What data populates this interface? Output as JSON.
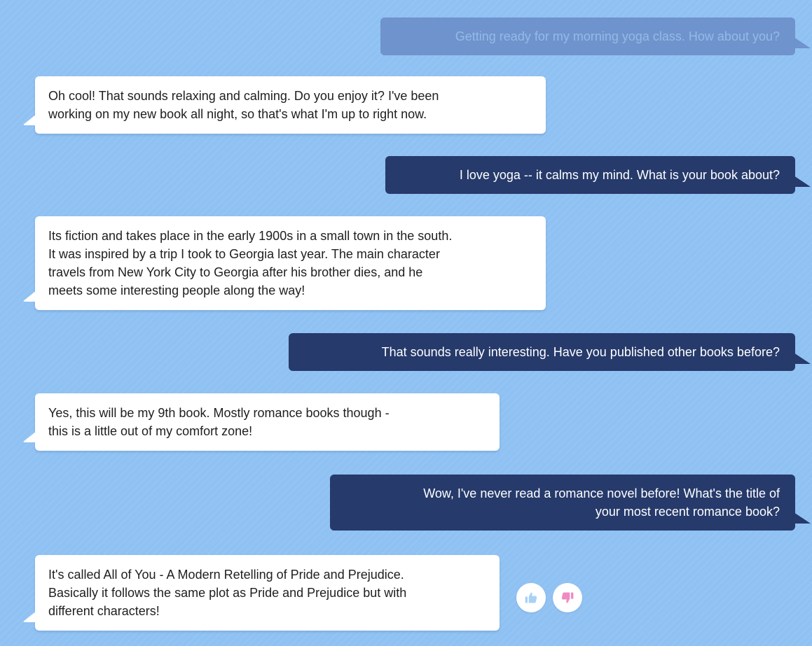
{
  "messages": [
    {
      "role": "user",
      "faded": true,
      "lines": [
        "Getting ready for my morning yoga class. How about you?"
      ]
    },
    {
      "role": "bot",
      "lines": [
        "Oh cool! That sounds relaxing and calming. Do you enjoy it? I've been",
        "working on my new book all night, so that's what I'm up to right now."
      ]
    },
    {
      "role": "user",
      "lines": [
        "I love yoga -- it calms my mind. What is your book about?"
      ]
    },
    {
      "role": "bot",
      "lines": [
        "Its fiction and takes place in the early 1900s in a small town in the south.",
        "It was inspired by a trip I took to Georgia last year. The main character",
        "travels from New York City to Georgia after his brother dies, and he",
        "meets some interesting people along the way!"
      ]
    },
    {
      "role": "user",
      "lines": [
        "That sounds really interesting. Have you published other books before?"
      ]
    },
    {
      "role": "bot",
      "lines": [
        "Yes, this will be my 9th book. Mostly romance books though -",
        "this is a little out of my comfort zone!"
      ]
    },
    {
      "role": "user",
      "lines": [
        "Wow, I've never read a romance novel before! What's the title of",
        "your most recent romance book?"
      ]
    },
    {
      "role": "bot",
      "lines": [
        "It's called All of You - A Modern Retelling of Pride and Prejudice.",
        "Basically it follows the same plot as Pride and Prejudice but with",
        "different characters!"
      ]
    }
  ],
  "feedback": {
    "thumbs_up_icon": "thumbs-up-icon",
    "thumbs_down_icon": "thumbs-down-icon",
    "thumbs_up_color": "#a8d1f7",
    "thumbs_down_color": "#f08ac0"
  },
  "colors": {
    "background": "#8fc1f3",
    "user_bubble": "#263a6b",
    "user_bubble_faded": "#6f93cd",
    "bot_bubble": "#ffffff"
  }
}
